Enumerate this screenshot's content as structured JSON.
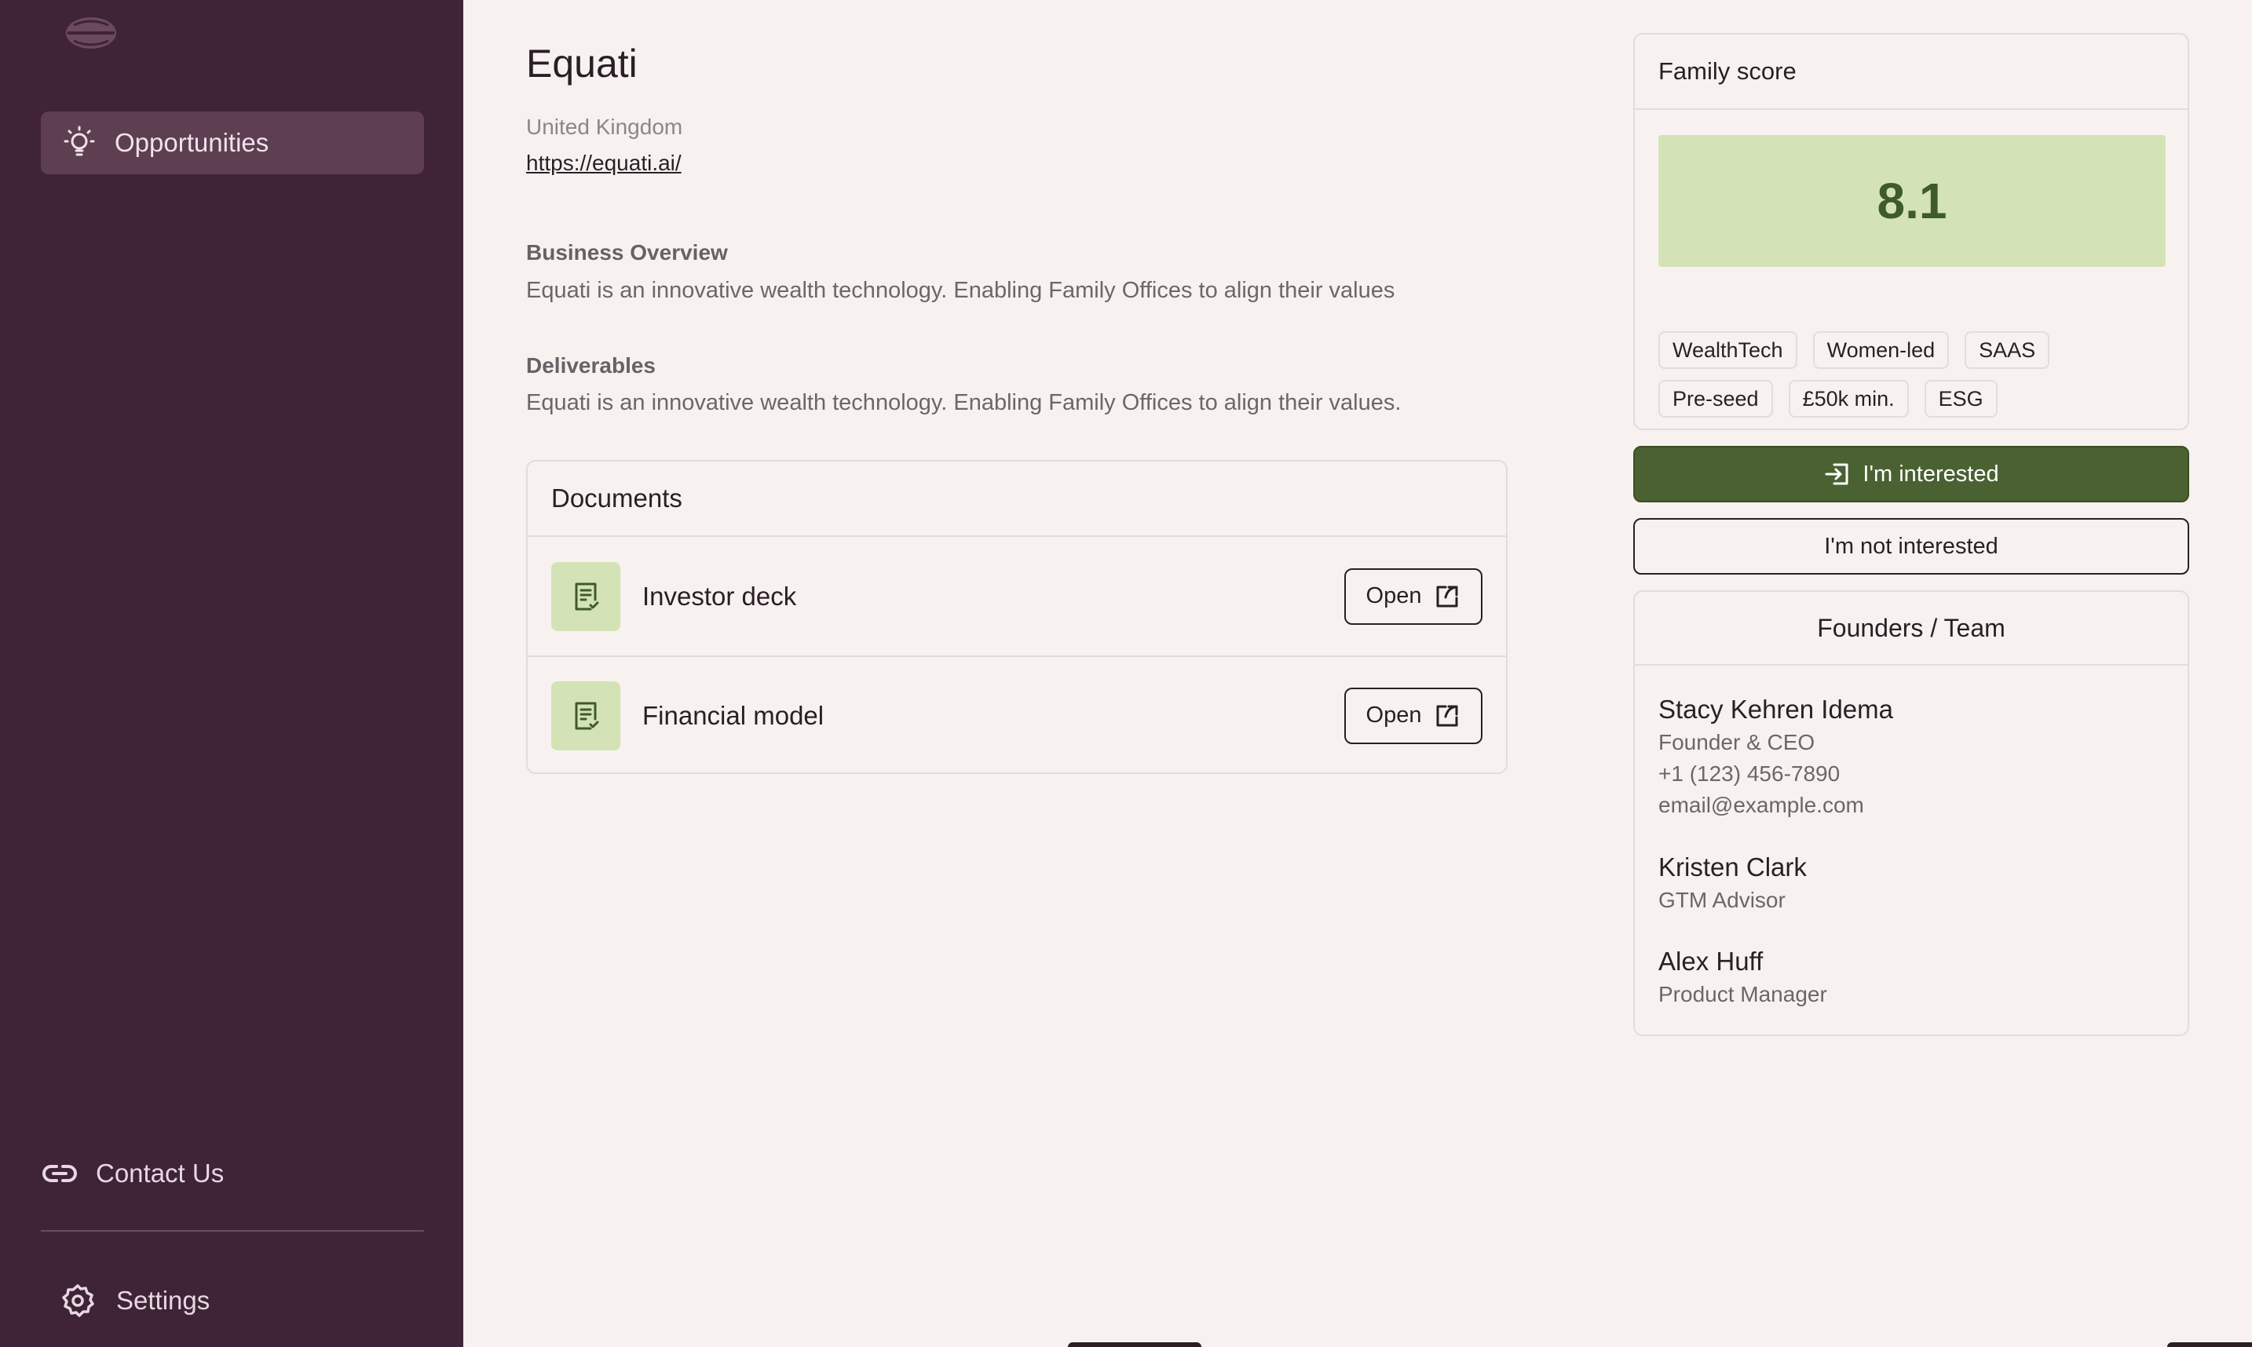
{
  "sidebar": {
    "logo_icon": "brand-logo-icon",
    "nav_active": {
      "label": "Opportunities",
      "icon": "lightbulb-icon"
    },
    "contact": {
      "label": "Contact Us",
      "icon": "link-icon"
    },
    "settings": {
      "label": "Settings",
      "icon": "gear-icon"
    }
  },
  "company": {
    "name": "Equati",
    "country": "United Kingdom",
    "url": "https://equati.ai/"
  },
  "sections": {
    "overview_label": "Business Overview",
    "overview_text": "Equati is an innovative wealth technology. Enabling Family Offices to align their values",
    "deliverables_label": "Deliverables",
    "deliverables_text": "Equati is an innovative wealth technology. Enabling Family Offices to align their values."
  },
  "documents": {
    "title": "Documents",
    "items": [
      {
        "label": "Investor deck",
        "button": "Open"
      },
      {
        "label": "Financial model",
        "button": "Open"
      }
    ]
  },
  "score": {
    "title": "Family score",
    "value": "8.1",
    "tags": [
      "WealthTech",
      "Women-led",
      "SAAS",
      "Pre-seed",
      "£50k min.",
      "ESG"
    ]
  },
  "actions": {
    "interested": "I'm interested",
    "not_interested": "I'm not interested"
  },
  "team": {
    "title": "Founders / Team",
    "members": [
      {
        "name": "Stacy Kehren Idema",
        "role": "Founder & CEO",
        "phone": "+1 (123) 456-7890",
        "email": "email@example.com"
      },
      {
        "name": "Kristen Clark",
        "role": "GTM Advisor"
      },
      {
        "name": "Alex Huff",
        "role": "Product Manager"
      }
    ]
  },
  "colors": {
    "sidebar_bg": "#3f2336",
    "accent_green": "#4a6132",
    "score_bg": "#d4e3b6",
    "page_bg": "#f7f2ef"
  }
}
